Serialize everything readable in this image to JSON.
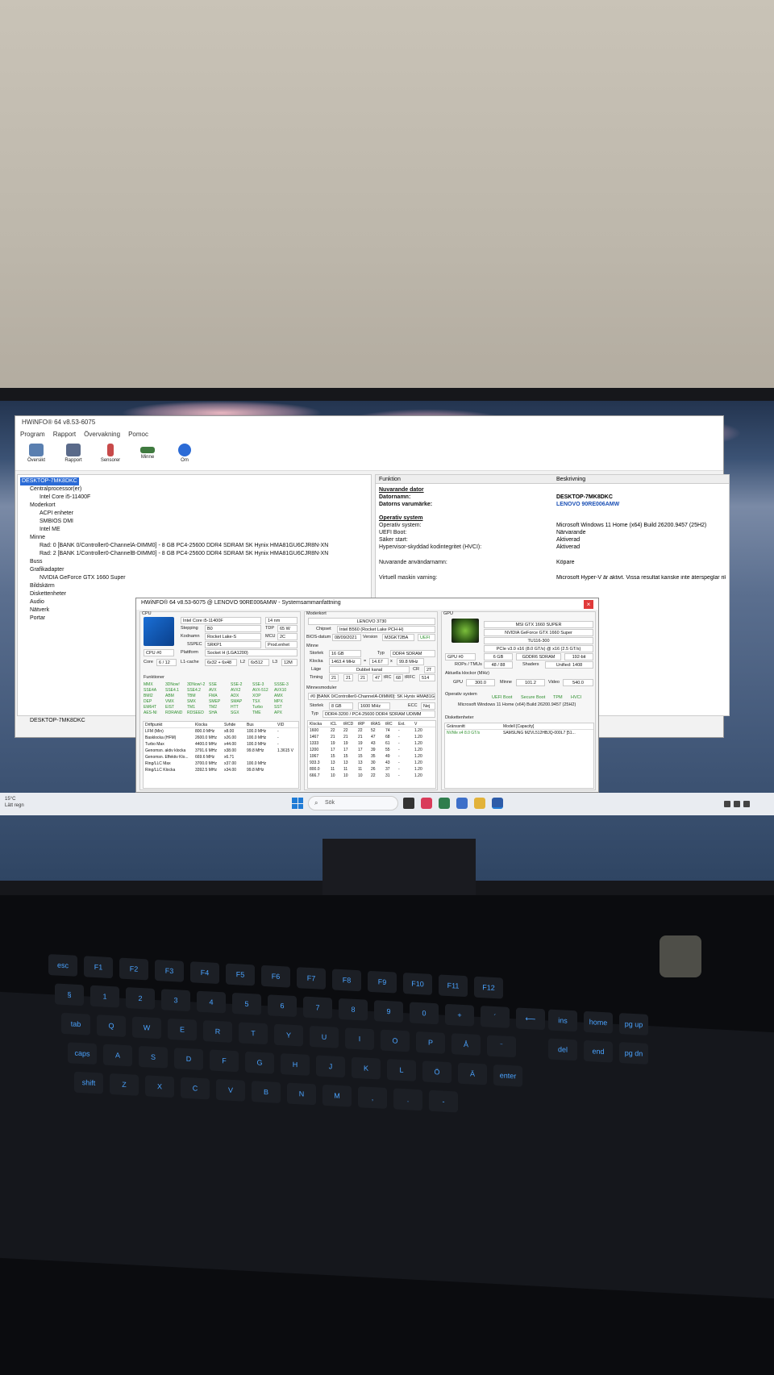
{
  "hwinfo": {
    "title": "HWiNFO® 64 v8.53-6075",
    "menu": [
      "Program",
      "Rapport",
      "Övervakning",
      "Pomoc"
    ],
    "toolbar": [
      "Översikt",
      "Rapport",
      "Sensorer",
      "Minne",
      "Om"
    ],
    "tree": [
      "DESKTOP-7MK8DKC",
      "Centralprocessor(er)",
      "Intel Core i5-11400F",
      "Moderkort",
      "ACPI enheter",
      "SMBIOS DMI",
      "Intel ME",
      "Minne",
      "Rad: 0 [BANK 0/Controller0-ChannelA-DIMM0] - 8 GB PC4-25600 DDR4 SDRAM SK Hynix HMA81GU6CJR8N-XN",
      "Rad: 2 [BANK 1/Controller0-ChannelB-DIMM0] - 8 GB PC4-25600 DDR4 SDRAM SK Hynix HMA81GU6CJR8N-XN",
      "Buss",
      "Grafikadapter",
      "NVIDIA GeForce GTX 1660 Super",
      "Bildskärm",
      "Diskettenheter",
      "Audio",
      "Nätverk",
      "Portar"
    ],
    "panel_headers": [
      "Funktion",
      "Beskrivning"
    ],
    "panel_rows": [
      {
        "k": "Nuvarande dator",
        "v": ""
      },
      {
        "k": "Datornamn:",
        "v": "DESKTOP-7MK8DKC"
      },
      {
        "k": "Datorns varumärke:",
        "v": "LENOVO 90RE006AMW"
      },
      {
        "k": "Operativ system",
        "v": ""
      },
      {
        "k": "Operativ system:",
        "v": "Microsoft Windows 11 Home (x64) Build 26200.9457 (25H2)"
      },
      {
        "k": "UEFI Boot:",
        "v": "Närvarande"
      },
      {
        "k": "Säker start:",
        "v": "Aktiverad"
      },
      {
        "k": "Hypervisor-skyddad kodintegritet (HVCI):",
        "v": "Aktiverad"
      },
      {
        "k": "Nuvarande användarnamn:",
        "v": "Köpare"
      },
      {
        "k": "Virtuell maskin varning:",
        "v": "Microsoft Hyper-V är aktivt. Vissa resultat kanske inte återspeglar rikti..."
      }
    ],
    "status": "DESKTOP-7MK8DKC"
  },
  "summary": {
    "title": "HWiNFO® 64 v8.53-6075 @ LENOVO 90RE006AMW - Systemsammanfattning",
    "cpu": {
      "section": "CPU",
      "name": "Intel Core i5-11400F",
      "nm": "14 nm",
      "stepping_l": "Stepping",
      "stepping": "B0",
      "tdp_l": "TDP",
      "tdp": "65 W",
      "codename_l": "Kodnamn",
      "codename": "Rocket Lake-S",
      "mcu_l": "MCU",
      "mcu": "2C",
      "sspec_l": "SSPEC",
      "sspec": "SRKP1",
      "prod": "Prod.enhet",
      "select": "CPU #0",
      "platform_l": "Plattform",
      "platform": "Socket H (LGA1200)",
      "core_l": "Core",
      "core": "6 / 12",
      "l1_l": "L1-cache",
      "l1": "6x32 + 6x48",
      "l2_l": "L2",
      "l2": "6x512",
      "l3_l": "L3",
      "l3": "12M",
      "funk": "Funktioner",
      "features": [
        "MMX",
        "3DNow!",
        "3DNow!-2",
        "SSE",
        "SSE-2",
        "SSE-3",
        "SSSE-3",
        "SSE4A",
        "SSE4.1",
        "SSE4.2",
        "AVX",
        "AVX2",
        "AVX-512",
        "AVX10",
        "BMI2",
        "ABM",
        "TBM",
        "FMA",
        "ADX",
        "XOP",
        "AMX",
        "DEP",
        "VMX",
        "SMX",
        "SMEP",
        "SMAP",
        "TSX",
        "MPX",
        "EM64T",
        "EIST",
        "TM1",
        "TM2",
        "HTT",
        "Turbo",
        "SST",
        "AES-NI",
        "RDRAND",
        "RDSEED",
        "SHA",
        "SGX",
        "TME",
        "APX"
      ],
      "table_head": [
        "Driftpunkt",
        "Klocka",
        "Svhde",
        "Bus",
        "VID"
      ],
      "table": [
        [
          "LFM (Min)",
          "800.0 MHz",
          "x8.00",
          "100.0 MHz",
          "-"
        ],
        [
          "Basklocka (HFM)",
          "2600.0 MHz",
          "x26.00",
          "100.0 MHz",
          "-"
        ],
        [
          "Turbo Max",
          "4400.0 MHz",
          "x44.00",
          "100.0 MHz",
          "-"
        ],
        [
          "Genomsn. aktiv klocka",
          "3791.6 MHz",
          "x38.00",
          "99.8 MHz",
          "1.3615 V"
        ],
        [
          "Genomsn. Effektiv Klo...",
          "669.6 MHz",
          "x6.71",
          "",
          ""
        ],
        [
          "Ring/LLC Max",
          "3700.0 MHz",
          "x37.00",
          "100.0 MHz",
          ""
        ],
        [
          "Ring/LLC Klocka",
          "3392.5 MHz",
          "x34.00",
          "99.8 MHz",
          ""
        ]
      ]
    },
    "mb": {
      "section": "Moderkort",
      "name": "LENOVO 3730",
      "chipset_l": "Chipset",
      "chipset": "Intel B560 (Rocket Lake PCH-H)",
      "bios_l": "BIOS-datum",
      "bios": "08/09/2021",
      "version_l": "Version",
      "version": "M3GKT2BA",
      "uefi": "UEFI",
      "mem_section": "Minne",
      "size_l": "Storlek",
      "size": "16 GB",
      "type_l": "Typ",
      "type": "DDR4 SDRAM",
      "clock_l": "Klocka",
      "clock": "1463.4 MHz",
      "eq": "=",
      "mult": "14.67",
      "x": "x",
      "bclk": "99.8 MHz",
      "mode_l": "Läge",
      "mode": "Dubbel kanal",
      "cr_l": "CR",
      "cr": "2T",
      "timing_l": "Timing",
      "t1": "21",
      "t2": "21",
      "t3": "21",
      "t4": "47",
      "trc_l": "tRC",
      "trc": "68",
      "trfc_l": "tRFC",
      "trfc": "514",
      "modules_l": "Minnesmoduler",
      "module": "#0 [BANK 0/Controller0-ChannelA-DIMM0]: SK Hynix HMA81GU6C",
      "msize_l": "Storlek",
      "msize": "8 GB",
      "mclock": "1600 MHz",
      "ecc_l": "ECC",
      "ecc": "Nej",
      "mtype_l": "Typ",
      "mtype": "DDR4-3200 / PC4-25600 DDR4 SDRAM UDIMM",
      "table_head": [
        "Klocka",
        "tCL",
        "tRCD",
        "tRP",
        "tRAS",
        "tRC",
        "Ext.",
        "V"
      ],
      "table": [
        [
          "1600",
          "22",
          "22",
          "22",
          "52",
          "74",
          "-",
          "1.20"
        ],
        [
          "1467",
          "21",
          "21",
          "21",
          "47",
          "68",
          "-",
          "1.20"
        ],
        [
          "1333",
          "19",
          "19",
          "19",
          "43",
          "61",
          "-",
          "1.20"
        ],
        [
          "1200",
          "17",
          "17",
          "17",
          "39",
          "55",
          "-",
          "1.20"
        ],
        [
          "1067",
          "15",
          "15",
          "15",
          "35",
          "49",
          "-",
          "1.20"
        ],
        [
          "933.3",
          "13",
          "13",
          "13",
          "30",
          "43",
          "-",
          "1.20"
        ],
        [
          "800.0",
          "11",
          "11",
          "11",
          "26",
          "37",
          "-",
          "1.20"
        ],
        [
          "666.7",
          "10",
          "10",
          "10",
          "22",
          "31",
          "-",
          "1.20"
        ]
      ]
    },
    "gpu": {
      "section": "GPU",
      "name1": "MSI GTX 1660 SUPER",
      "name2": "NVIDIA GeForce GTX 1660 Super",
      "chip": "TU116-300",
      "bus": "PCIe v3.0 x16 (8.0 GT/s) @ x16 (2.5 GT/s)",
      "select": "GPU #0",
      "vram": "6 GB",
      "vtype": "GDDR6 SDRAM",
      "width": "192-bit",
      "rops_l": "ROPs / TMUs",
      "rops": "48 / 88",
      "shaders_l": "Shaders",
      "shaders": "Unified: 1408",
      "clocks_l": "Aktuella klockor (MHz)",
      "gpu_l": "GPU",
      "gpu": "300.0",
      "mem_l": "Minne",
      "mem": "101.2",
      "video_l": "Video",
      "video": "540.0",
      "os_l": "Operativ system",
      "uefi": "UEFI Boot",
      "secure": "Secure Boot",
      "tpm": "TPM",
      "hvci": "HVCI",
      "os": "Microsoft Windows 11 Home (x64) Build 26200.9457 (25H2)",
      "disk_l": "Diskettenheter",
      "iface_l": "Gränssnitt",
      "model_l": "Modell [Capacity]",
      "iface": "NVMe x4 8.0 GT/s",
      "model": "SAMSUNG MZVL512HBJQ-000L7 [51..."
    }
  },
  "taskbar": {
    "weather_temp": "15°C",
    "weather_text": "Lätt regn",
    "search": "Sök"
  },
  "keyboard": {
    "row1": [
      "esc",
      "F1",
      "F2",
      "F3",
      "F4",
      "F5",
      "F6",
      "F7",
      "F8",
      "F9",
      "F10",
      "F11",
      "F12"
    ],
    "row2": [
      "§",
      "1",
      "2",
      "3",
      "4",
      "5",
      "6",
      "7",
      "8",
      "9",
      "0",
      "+",
      "´",
      "⟵"
    ],
    "row3": [
      "tab",
      "Q",
      "W",
      "E",
      "R",
      "T",
      "Y",
      "U",
      "I",
      "O",
      "P",
      "Å",
      "¨"
    ],
    "row4": [
      "caps",
      "A",
      "S",
      "D",
      "F",
      "G",
      "H",
      "J",
      "K",
      "L",
      "Ö",
      "Ä",
      "enter"
    ],
    "row5": [
      "shift",
      "Z",
      "X",
      "C",
      "V",
      "B",
      "N",
      "M",
      ",",
      ".",
      "-"
    ],
    "nav": [
      "ins",
      "home",
      "pg up",
      "del",
      "end",
      "pg dn"
    ]
  }
}
